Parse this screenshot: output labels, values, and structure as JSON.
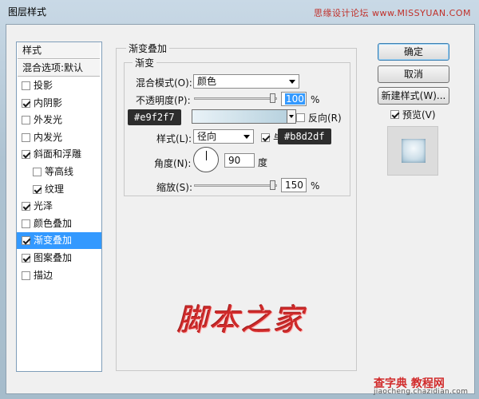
{
  "window": {
    "title": "图层样式",
    "watermark_top": "思缘设计论坛 www.MISSYUAN.COM"
  },
  "left_panel": {
    "header_style": "样式",
    "header_blend": "混合选项:默认",
    "items": [
      {
        "label": "投影",
        "checked": false,
        "sub": false,
        "selected": false
      },
      {
        "label": "内阴影",
        "checked": true,
        "sub": false,
        "selected": false
      },
      {
        "label": "外发光",
        "checked": false,
        "sub": false,
        "selected": false
      },
      {
        "label": "内发光",
        "checked": false,
        "sub": false,
        "selected": false
      },
      {
        "label": "斜面和浮雕",
        "checked": true,
        "sub": false,
        "selected": false
      },
      {
        "label": "等高线",
        "checked": false,
        "sub": true,
        "selected": false
      },
      {
        "label": "纹理",
        "checked": true,
        "sub": true,
        "selected": false
      },
      {
        "label": "光泽",
        "checked": true,
        "sub": false,
        "selected": false
      },
      {
        "label": "颜色叠加",
        "checked": false,
        "sub": false,
        "selected": false
      },
      {
        "label": "渐变叠加",
        "checked": true,
        "sub": false,
        "selected": true
      },
      {
        "label": "图案叠加",
        "checked": true,
        "sub": false,
        "selected": false
      },
      {
        "label": "描边",
        "checked": false,
        "sub": false,
        "selected": false
      }
    ]
  },
  "main": {
    "group_title": "渐变叠加",
    "subgroup_title": "渐变",
    "blend_mode_label": "混合模式(O):",
    "blend_mode_value": "颜色",
    "opacity_label": "不透明度(P):",
    "opacity_value": "100",
    "percent": "%",
    "gradient_start_color": "#e9f2f7",
    "gradient_end_color": "#b8d2df",
    "reverse_label": "反向(R)",
    "style_label": "样式(L):",
    "style_value": "径向",
    "align_label_partial": "与",
    "angle_label": "角度(N):",
    "angle_value": "90",
    "degree": "度",
    "scale_label": "缩放(S):",
    "scale_value": "150",
    "scale_percent": "%",
    "tag_start": "#e9f2f7",
    "tag_end": "#b8d2df"
  },
  "buttons": {
    "ok": "确定",
    "cancel": "取消",
    "new_style": "新建样式(W)...",
    "preview_label": "预览(V)"
  },
  "logo_text": "脚本之家",
  "bottom_watermark": {
    "line1": "查字典 教程网",
    "line2": "jiaocheng.chazidian.com"
  }
}
